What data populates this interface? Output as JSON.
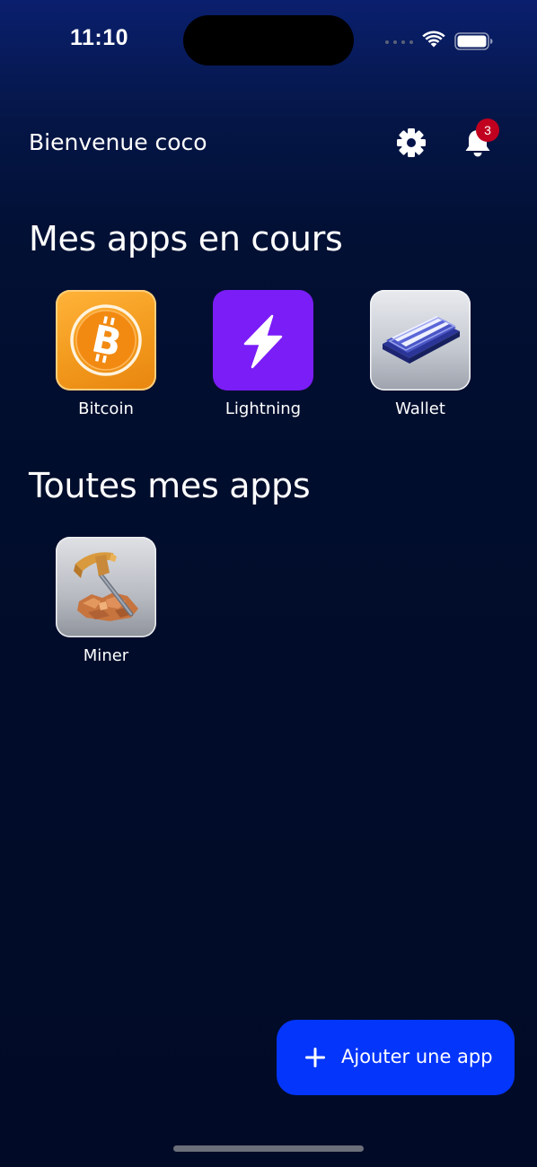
{
  "status_bar": {
    "time": "11:10"
  },
  "header": {
    "welcome": "Bienvenue coco",
    "notification_count": "3"
  },
  "sections": {
    "current_apps": {
      "title": "Mes apps en cours",
      "items": [
        {
          "label": "Bitcoin",
          "icon": "bitcoin-icon"
        },
        {
          "label": "Lightning",
          "icon": "lightning-icon"
        },
        {
          "label": "Wallet",
          "icon": "wallet-icon"
        }
      ]
    },
    "all_apps": {
      "title": "Toutes mes apps",
      "items": [
        {
          "label": "Miner",
          "icon": "miner-icon"
        }
      ]
    }
  },
  "fab": {
    "label": "Ajouter une app"
  },
  "colors": {
    "accent": "#0435fb",
    "badge": "#c1001f",
    "lightning": "#7b1df7",
    "bitcoin": "#f7931a"
  }
}
